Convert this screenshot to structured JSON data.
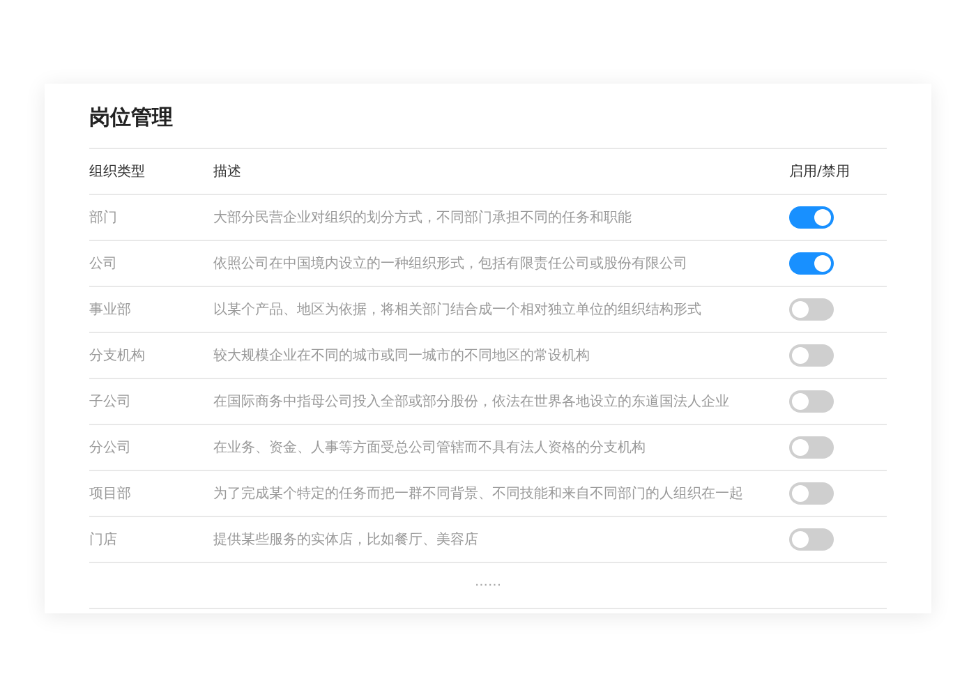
{
  "title": "岗位管理",
  "columns": [
    "组织类型",
    "描述",
    "启用/禁用"
  ],
  "rows": [
    {
      "type": "部门",
      "description": "大部分民营企业对组织的划分方式，不同部门承担不同的任务和职能",
      "on": true
    },
    {
      "type": "公司",
      "description": "依照公司在中国境内设立的一种组织形式，包括有限责任公司或股份有限公司",
      "on": true
    },
    {
      "type": "事业部",
      "description": "以某个产品、地区为依据，将相关部门结合成一个相对独立单位的组织结构形式",
      "on": false
    },
    {
      "type": "分支机构",
      "description": "较大规模企业在不同的城市或同一城市的不同地区的常设机构",
      "on": false
    },
    {
      "type": "子公司",
      "description": "在国际商务中指母公司投入全部或部分股份，依法在世界各地设立的东道国法人企业",
      "on": false
    },
    {
      "type": "分公司",
      "description": "在业务、资金、人事等方面受总公司管辖而不具有法人资格的分支机构",
      "on": false
    },
    {
      "type": "项目部",
      "description": "为了完成某个特定的任务而把一群不同背景、不同技能和来自不同部门的人组织在一起",
      "on": false
    },
    {
      "type": "门店",
      "description": "提供某些服务的实体店，比如餐厅、美容店",
      "on": false
    }
  ],
  "more": "······"
}
